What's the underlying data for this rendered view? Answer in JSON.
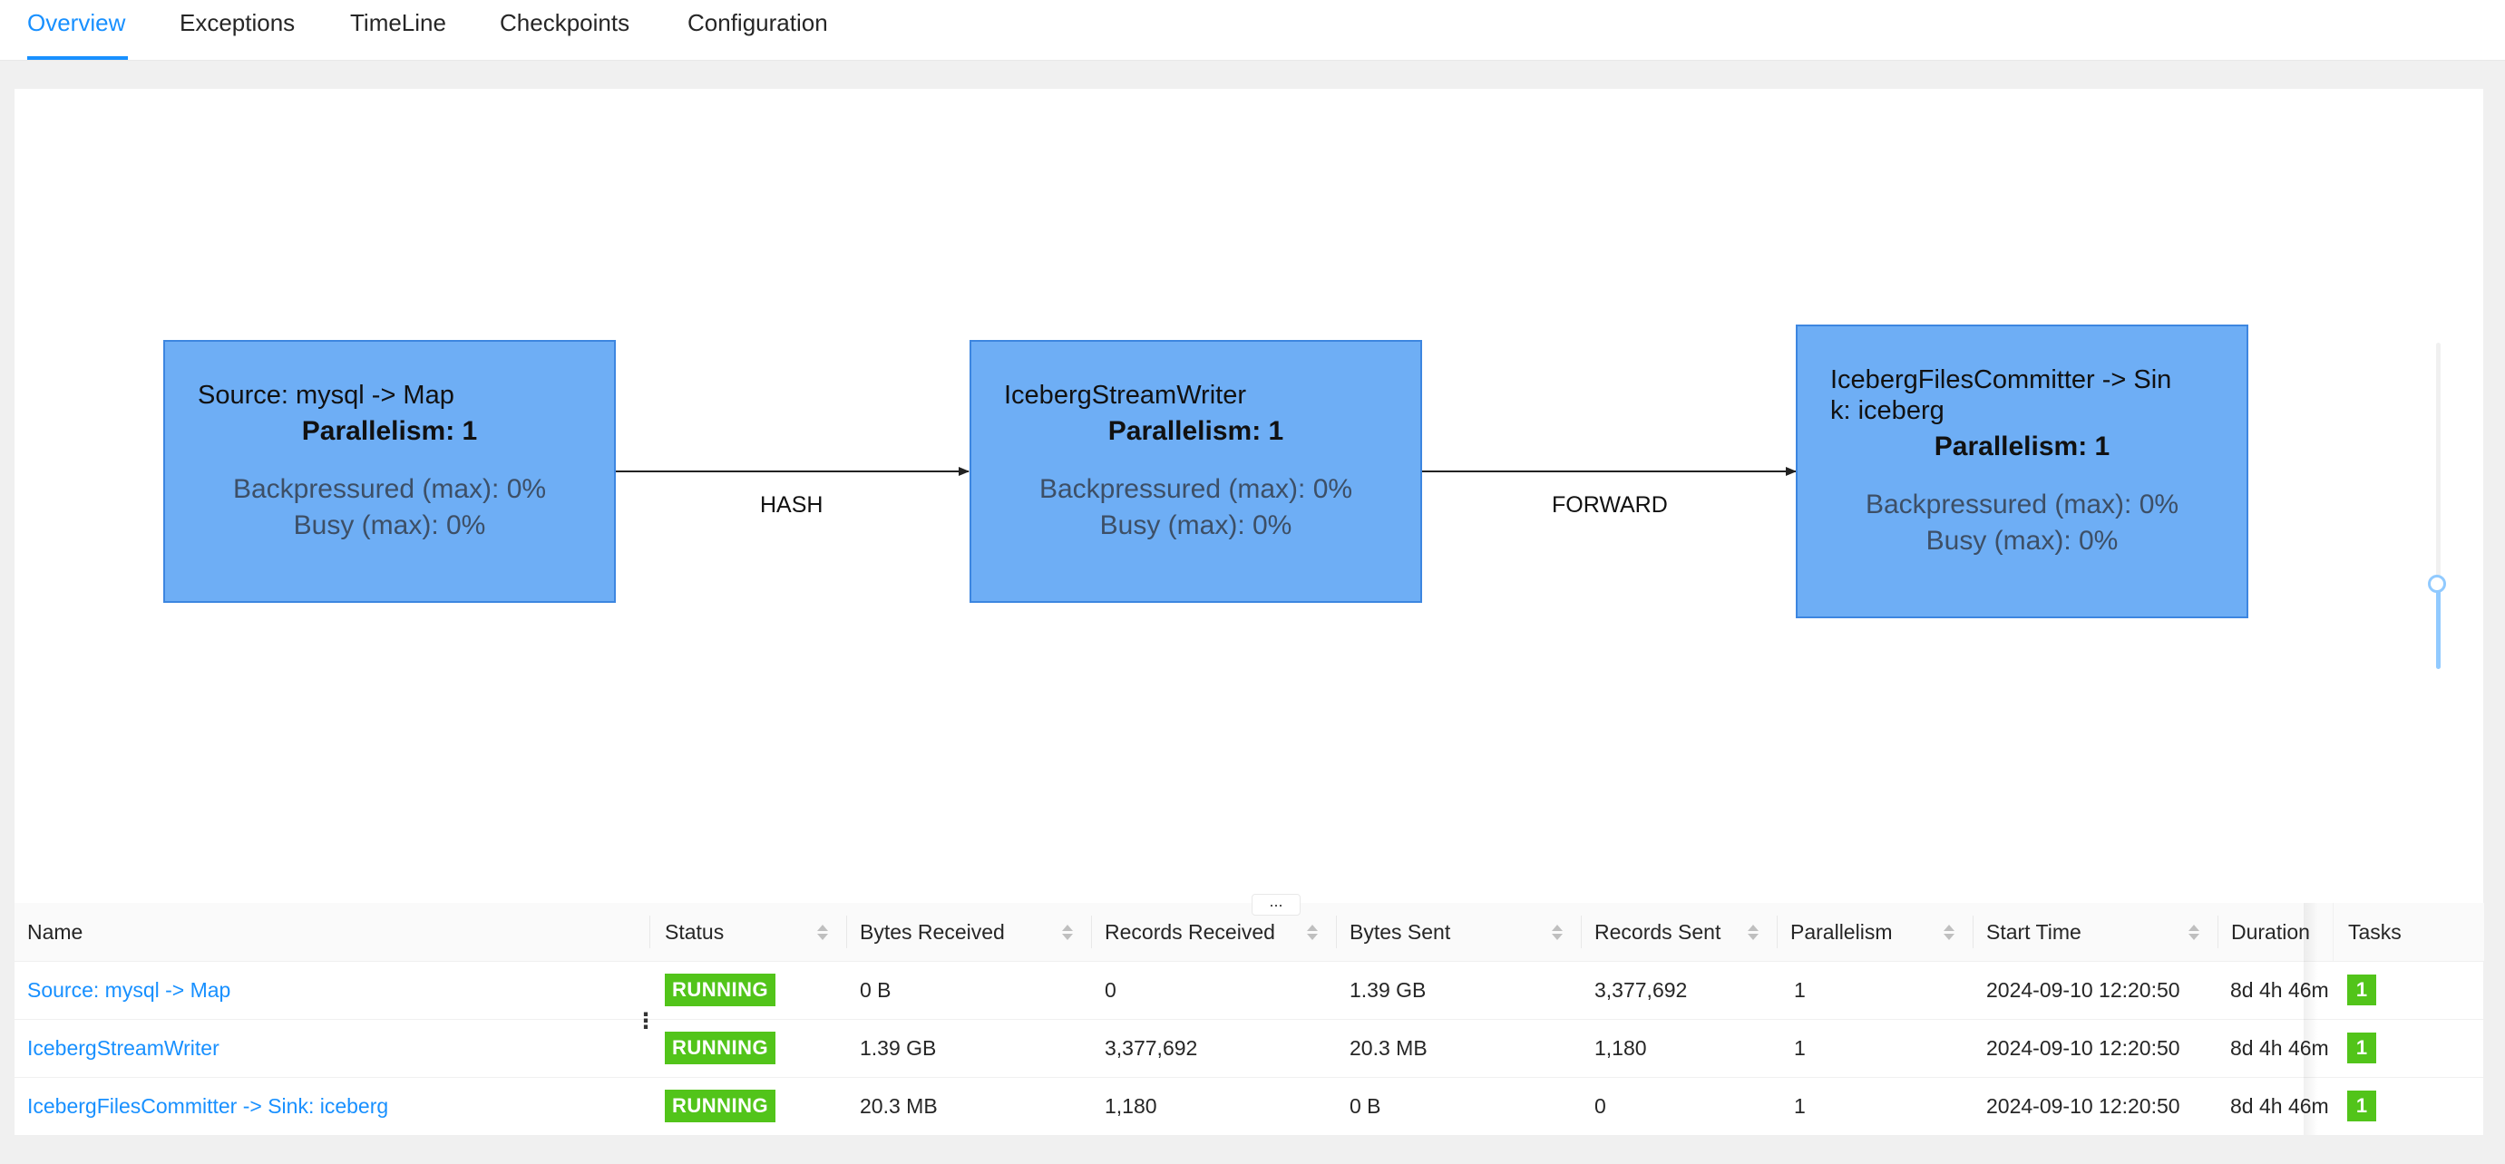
{
  "tabs": [
    {
      "label": "Overview",
      "active": true
    },
    {
      "label": "Exceptions",
      "active": false
    },
    {
      "label": "TimeLine",
      "active": false
    },
    {
      "label": "Checkpoints",
      "active": false
    },
    {
      "label": "Configuration",
      "active": false
    }
  ],
  "graph": {
    "nodes": [
      {
        "title": "Source: mysql -> Map",
        "parallelism": "Parallelism: 1",
        "backpressured": "Backpressured (max): 0%",
        "busy": "Busy (max): 0%"
      },
      {
        "title": "IcebergStreamWriter",
        "parallelism": "Parallelism: 1",
        "backpressured": "Backpressured (max): 0%",
        "busy": "Busy (max): 0%"
      },
      {
        "title": "IcebergFilesCommitter -> Sin\nk: iceberg",
        "parallelism": "Parallelism: 1",
        "backpressured": "Backpressured (max): 0%",
        "busy": "Busy (max): 0%"
      }
    ],
    "edges": [
      {
        "label": "HASH"
      },
      {
        "label": "FORWARD"
      }
    ],
    "colors": {
      "node_fill": "#6eaef5",
      "node_border": "#3d86e0"
    },
    "resize_handle": "..."
  },
  "table": {
    "columns": [
      "Name",
      "Status",
      "Bytes Received",
      "Records Received",
      "Bytes Sent",
      "Records Sent",
      "Parallelism",
      "Start Time",
      "Duration",
      "Tasks"
    ],
    "rows": [
      {
        "name": "Source: mysql -> Map",
        "status": "RUNNING",
        "bytes_received": "0 B",
        "records_received": "0",
        "bytes_sent": "1.39 GB",
        "records_sent": "3,377,692",
        "parallelism": "1",
        "start_time": "2024-09-10 12:20:50",
        "duration": "8d 4h 46m",
        "tasks": "1"
      },
      {
        "name": "IcebergStreamWriter",
        "status": "RUNNING",
        "bytes_received": "1.39 GB",
        "records_received": "3,377,692",
        "bytes_sent": "20.3 MB",
        "records_sent": "1,180",
        "parallelism": "1",
        "start_time": "2024-09-10 12:20:50",
        "duration": "8d 4h 46m",
        "tasks": "1"
      },
      {
        "name": "IcebergFilesCommitter -> Sink: iceberg",
        "status": "RUNNING",
        "bytes_received": "20.3 MB",
        "records_received": "1,180",
        "bytes_sent": "0 B",
        "records_sent": "0",
        "parallelism": "1",
        "start_time": "2024-09-10 12:20:50",
        "duration": "8d 4h 46m",
        "tasks": "1"
      }
    ],
    "column_resize_handle": "⋮"
  },
  "colors": {
    "accent": "#1890ff",
    "running": "#52c41a"
  }
}
